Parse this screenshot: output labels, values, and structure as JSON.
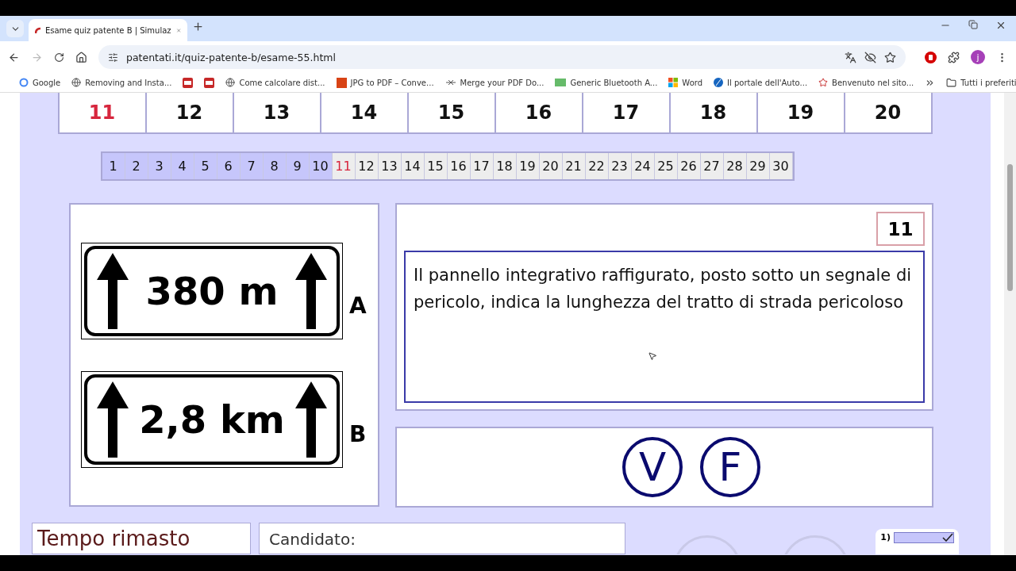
{
  "browser": {
    "tab_title": "Esame quiz patente B | Simulaz",
    "url": "patentati.it/quiz-patente-b/esame-55.html",
    "profile_initial": "j",
    "bookmarks": [
      {
        "label": "Google",
        "kind": "google"
      },
      {
        "label": "Removing and Insta...",
        "kind": "globe"
      },
      {
        "kind": "pdf"
      },
      {
        "kind": "pdf"
      },
      {
        "label": "Come calcolare dist...",
        "kind": "globe"
      },
      {
        "label": "JPG to PDF – Conve...",
        "kind": "jpg"
      },
      {
        "label": "Merge your PDF Do...",
        "kind": "merge"
      },
      {
        "label": "Generic Bluetooth A...",
        "kind": "bluetooth"
      },
      {
        "label": "Word",
        "kind": "word"
      },
      {
        "label": "Il portale dell'Auto...",
        "kind": "portal"
      },
      {
        "label": "Benvenuto nel sito...",
        "kind": "star"
      }
    ],
    "all_bookmarks": "Tutti i preferiti"
  },
  "question_row": [
    {
      "label": "11",
      "selected": true
    },
    {
      "label": "12",
      "selected": false
    },
    {
      "label": "13",
      "selected": false
    },
    {
      "label": "14",
      "selected": false
    },
    {
      "label": "15",
      "selected": false
    },
    {
      "label": "16",
      "selected": false
    },
    {
      "label": "17",
      "selected": false
    },
    {
      "label": "18",
      "selected": false
    },
    {
      "label": "19",
      "selected": false
    },
    {
      "label": "20",
      "selected": false
    }
  ],
  "pager": [
    {
      "label": "1",
      "answered": true,
      "selected": false
    },
    {
      "label": "2",
      "answered": true,
      "selected": false
    },
    {
      "label": "3",
      "answered": true,
      "selected": false
    },
    {
      "label": "4",
      "answered": true,
      "selected": false
    },
    {
      "label": "5",
      "answered": true,
      "selected": false
    },
    {
      "label": "6",
      "answered": true,
      "selected": false
    },
    {
      "label": "7",
      "answered": true,
      "selected": false
    },
    {
      "label": "8",
      "answered": true,
      "selected": false
    },
    {
      "label": "9",
      "answered": true,
      "selected": false
    },
    {
      "label": "10",
      "answered": true,
      "selected": false
    },
    {
      "label": "11",
      "answered": false,
      "selected": true
    },
    {
      "label": "12",
      "answered": false,
      "selected": false
    },
    {
      "label": "13",
      "answered": false,
      "selected": false
    },
    {
      "label": "14",
      "answered": false,
      "selected": false
    },
    {
      "label": "15",
      "answered": false,
      "selected": false
    },
    {
      "label": "16",
      "answered": false,
      "selected": false
    },
    {
      "label": "17",
      "answered": false,
      "selected": false
    },
    {
      "label": "18",
      "answered": false,
      "selected": false
    },
    {
      "label": "19",
      "answered": false,
      "selected": false
    },
    {
      "label": "20",
      "answered": false,
      "selected": false
    },
    {
      "label": "21",
      "answered": false,
      "selected": false
    },
    {
      "label": "22",
      "answered": false,
      "selected": false
    },
    {
      "label": "23",
      "answered": false,
      "selected": false
    },
    {
      "label": "24",
      "answered": false,
      "selected": false
    },
    {
      "label": "25",
      "answered": false,
      "selected": false
    },
    {
      "label": "26",
      "answered": false,
      "selected": false
    },
    {
      "label": "27",
      "answered": false,
      "selected": false
    },
    {
      "label": "28",
      "answered": false,
      "selected": false
    },
    {
      "label": "29",
      "answered": false,
      "selected": false
    },
    {
      "label": "30",
      "answered": false,
      "selected": false
    }
  ],
  "signs": [
    {
      "text": "380 m",
      "letter": "A"
    },
    {
      "text": "2,8 km",
      "letter": "B"
    }
  ],
  "question": {
    "number": "11",
    "text": "Il pannello integrativo raffigurato, posto sotto un segnale di pericolo, indica la lunghezza del tratto di strada pericoloso"
  },
  "answers": [
    "V",
    "F"
  ],
  "footer": {
    "timer_label": "Tempo rimasto",
    "candidate_label": "Candidato:",
    "summary_label": "1)"
  }
}
